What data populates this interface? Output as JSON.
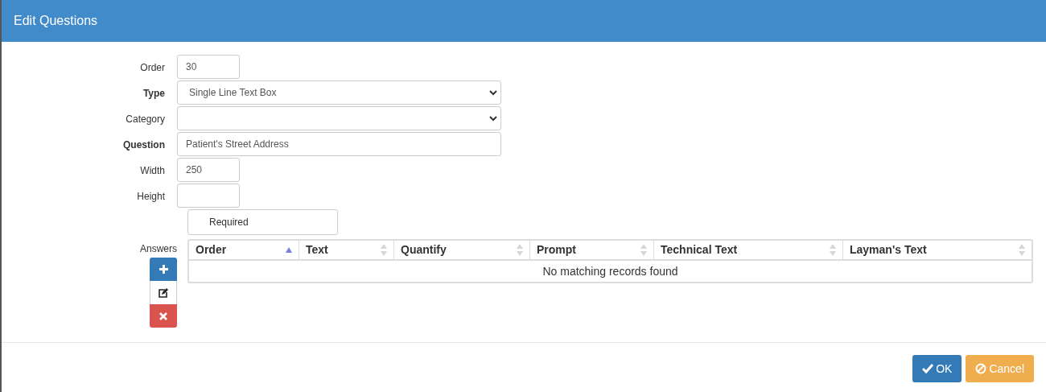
{
  "dialog": {
    "title": "Edit Questions"
  },
  "fields": [
    {
      "label": "Order",
      "kind": "number",
      "value": "30",
      "bold": false
    },
    {
      "label": "Type",
      "kind": "select",
      "value": "Single Line Text Box",
      "bold": true
    },
    {
      "label": "Category",
      "kind": "select",
      "bold": false
    },
    {
      "label": "Question",
      "kind": "text",
      "value": "Patient's Street Address",
      "bold": true
    },
    {
      "label": "Width",
      "kind": "number",
      "value": "250",
      "bold": false
    },
    {
      "label": "Height",
      "kind": "number",
      "bold": false
    }
  ],
  "required": {
    "label": "Required"
  },
  "answers": {
    "label": "Answers",
    "columns": [
      {
        "label": "Order",
        "sorted": true
      },
      {
        "label": "Text",
        "sorted": false
      },
      {
        "label": "Quantify",
        "sorted": false
      },
      {
        "label": "Prompt",
        "sorted": false
      },
      {
        "label": "Technical Text",
        "sorted": false
      },
      {
        "label": "Layman's Text",
        "sorted": false
      }
    ],
    "empty_message": "No matching records found"
  },
  "buttons": [
    {
      "label": "OK",
      "kind": "ok"
    },
    {
      "label": "Cancel",
      "kind": "cancel"
    }
  ]
}
